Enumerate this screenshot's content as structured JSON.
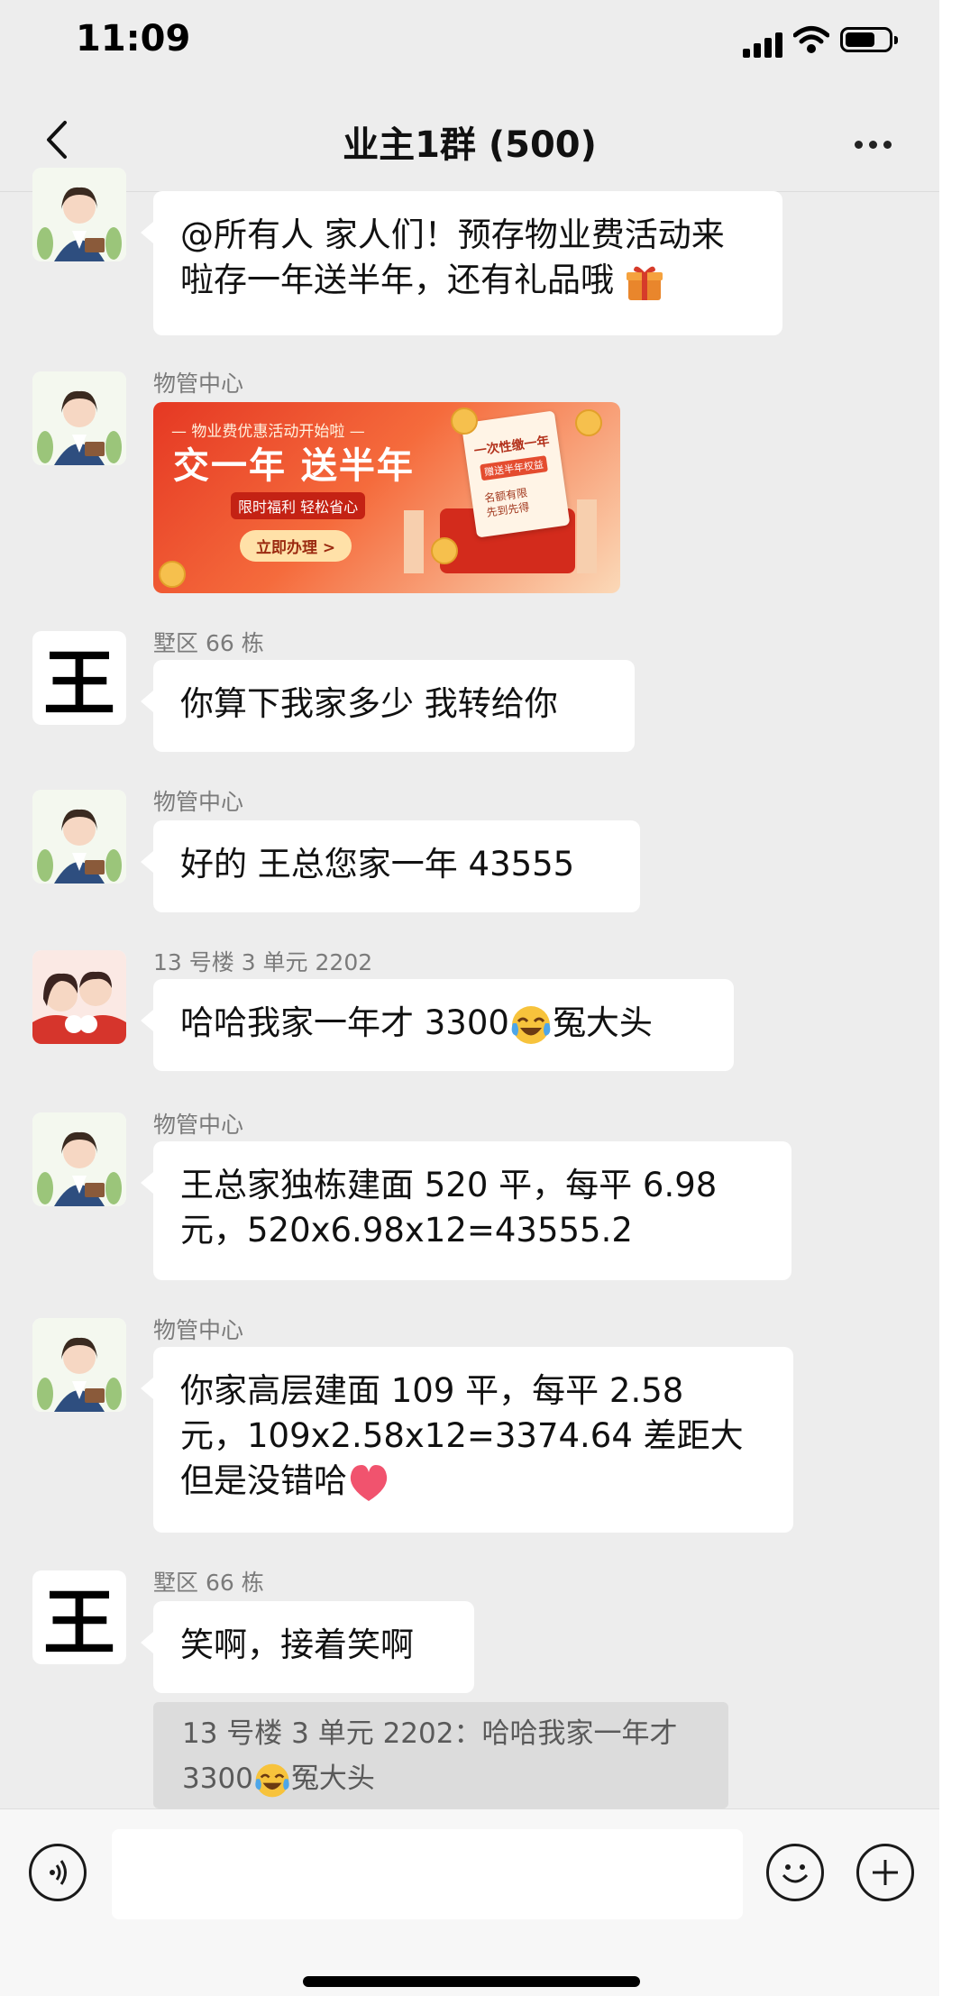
{
  "status_bar": {
    "time": "11:09"
  },
  "nav": {
    "title": "业主1群 (500)"
  },
  "messages": [
    {
      "sender": "",
      "avatar": "staff-avatar",
      "text": "@所有人 家人们！预存物业费活动来啦存一年送半年，还有礼品哦",
      "emoji": "gift"
    },
    {
      "sender": "物管中心",
      "avatar": "staff-avatar",
      "image": {
        "top_text": "— 物业费优惠活动开始啦 —",
        "headline": "交一年 送半年",
        "subline": "限时福利 轻松省心",
        "button": "立即办理 >",
        "ticket_title": "一次性缴一年",
        "ticket_tag": "赠送半年权益",
        "ticket_note1": "名额有限",
        "ticket_note2": "先到先得"
      }
    },
    {
      "sender": "墅区 66 栋",
      "avatar": "王",
      "text": "你算下我家多少 我转给你"
    },
    {
      "sender": "物管中心",
      "avatar": "staff-avatar",
      "text": "好的 王总您家一年 43555"
    },
    {
      "sender": "13 号楼 3 单元 2202",
      "avatar": "couple-avatar",
      "text_before": "哈哈我家一年才 3300",
      "emoji": "laugh-cry",
      "text_after": "冤大头"
    },
    {
      "sender": "物管中心",
      "avatar": "staff-avatar",
      "text_line1": "王总家独栋建面 520 平，每平 6.98",
      "text_line2": "元，520x6.98x12=43555.2"
    },
    {
      "sender": "物管中心",
      "avatar": "staff-avatar",
      "text_line1": "你家高层建面 109 平，每平 2.58",
      "text_line2": "元，109x2.58x12=3374.64 差距大",
      "text_line3": "但是没错哈",
      "emoji": "heart"
    },
    {
      "sender": "墅区 66 栋",
      "avatar": "王",
      "text": "笑啊，接着笑啊"
    }
  ],
  "quote": {
    "line1": "13 号楼 3 单元 2202：哈哈我家一年才",
    "line2_before": "3300",
    "line2_after": "冤大头"
  },
  "colors": {
    "background": "#ededed",
    "bubble": "#ffffff",
    "quote": "#dcdcdc"
  }
}
